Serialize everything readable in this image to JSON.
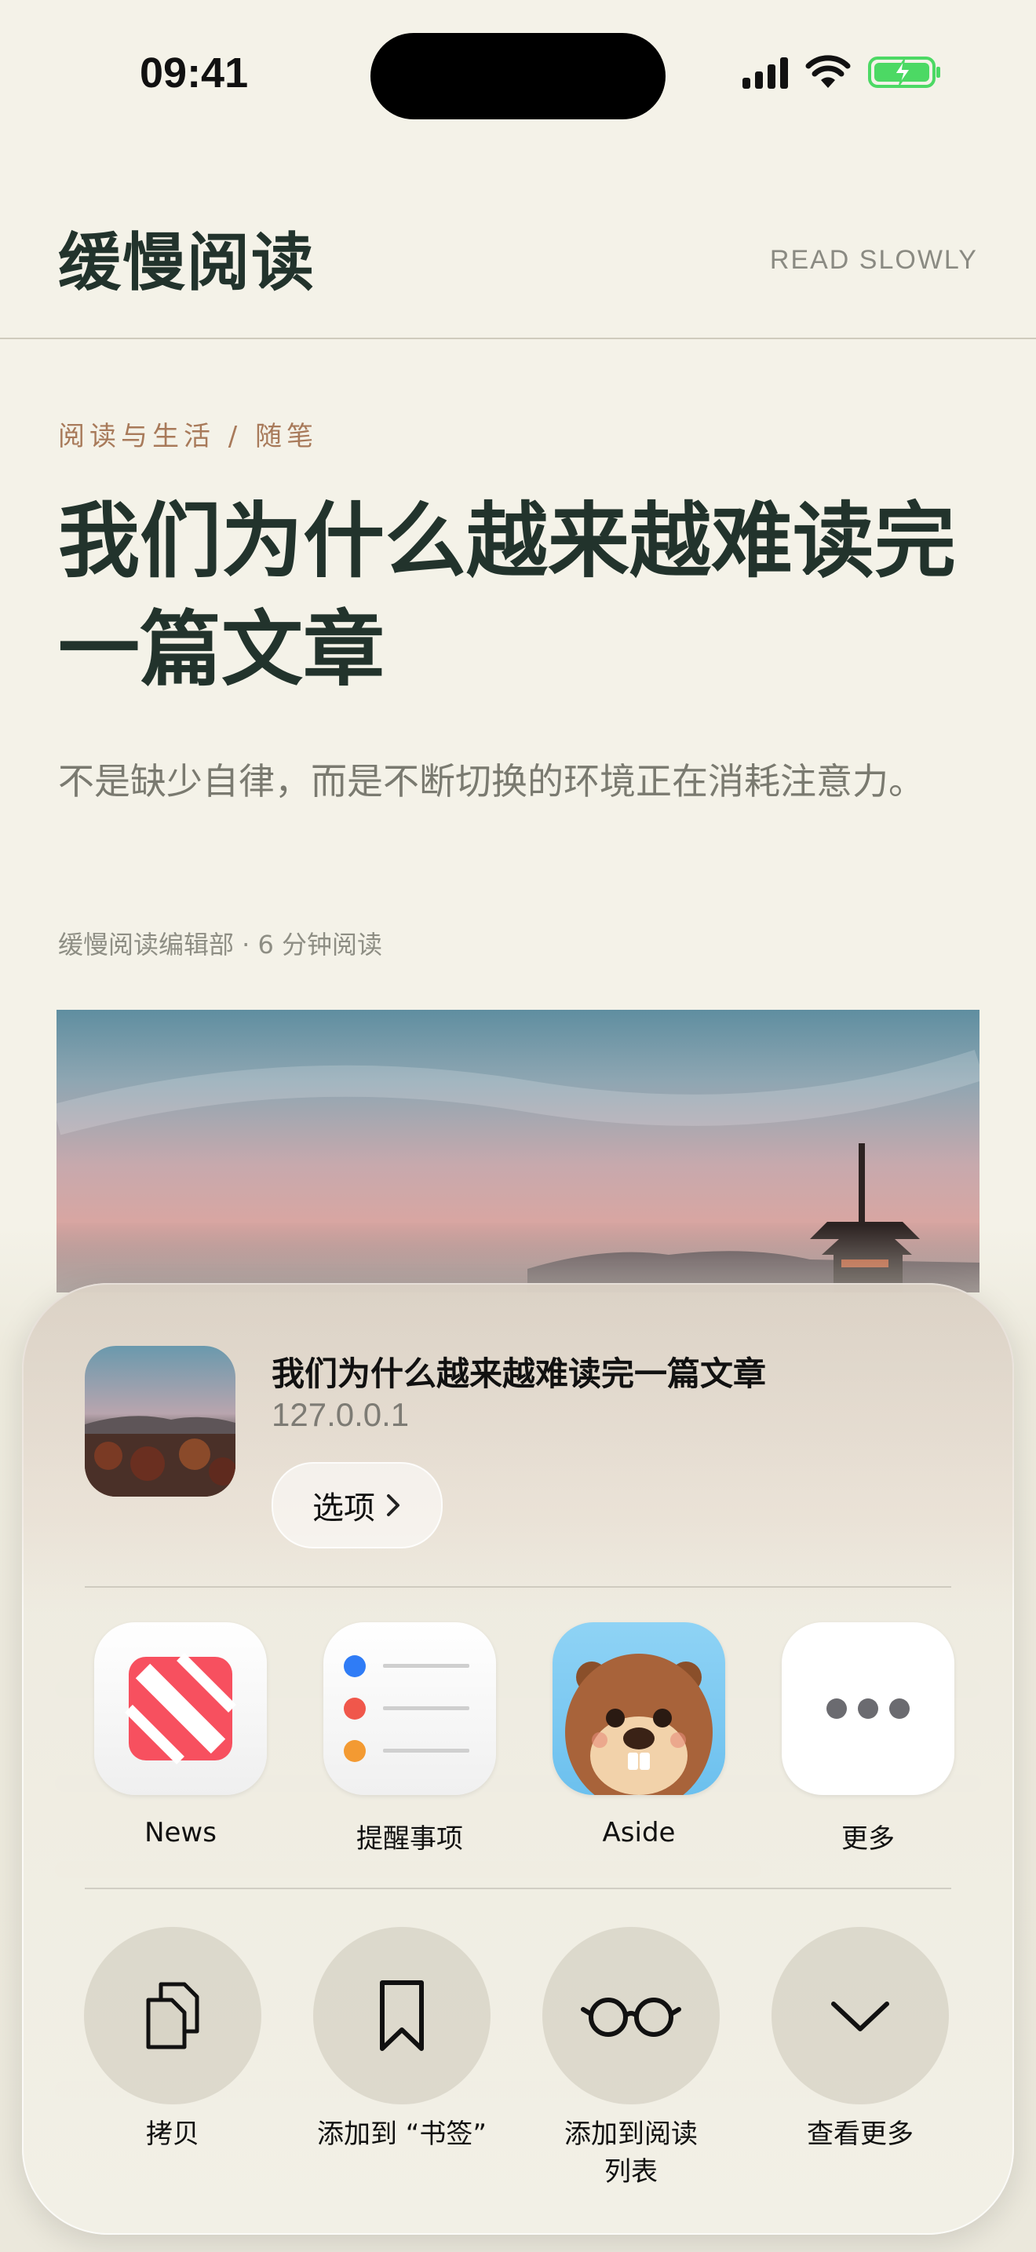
{
  "status_bar": {
    "time": "09:41"
  },
  "header": {
    "logo": "缓慢阅读",
    "tagline": "READ SLOWLY"
  },
  "article": {
    "breadcrumb": "阅读与生活 / 随笔",
    "title": "我们为什么越来越难读完一篇文章",
    "subtitle": "不是缺少自律，而是不断切换的环境正在消耗注意力。",
    "meta": "缓慢阅读编辑部 · 6 分钟阅读"
  },
  "share_sheet": {
    "preview": {
      "title": "我们为什么越来越难读完一篇文章",
      "url": "127.0.0.1",
      "options_label": "选项"
    },
    "apps": [
      {
        "label": "News",
        "icon": "news-icon"
      },
      {
        "label": "提醒事项",
        "icon": "reminders-icon"
      },
      {
        "label": "Aside",
        "icon": "beaver-icon"
      },
      {
        "label": "更多",
        "icon": "more-dots-icon"
      }
    ],
    "actions": [
      {
        "label": "拷贝",
        "icon": "copy-icon"
      },
      {
        "label": "添加到 “书签”",
        "icon": "bookmark-icon"
      },
      {
        "label": "添加到阅读列表",
        "icon": "glasses-icon"
      },
      {
        "label": "查看更多",
        "icon": "chevron-down-icon"
      }
    ]
  },
  "colors": {
    "accent_brown": "#a87a5a",
    "title_green": "#22332c",
    "news_red": "#f7505f",
    "battery_green": "#4cd964"
  }
}
